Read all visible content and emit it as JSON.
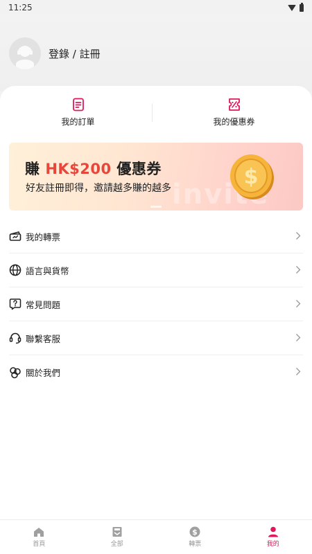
{
  "status_bar": {
    "time": "11:25"
  },
  "profile": {
    "login_label": "登錄 / 註冊"
  },
  "quick_links": [
    {
      "label": "我的訂單",
      "icon": "order-icon"
    },
    {
      "label": "我的優惠券",
      "icon": "coupon-icon"
    }
  ],
  "promo": {
    "title_prefix": "賺 ",
    "title_amount": "HK$200",
    "title_suffix": " 優惠券",
    "subtitle": "好友註冊即得，邀請越多賺的越多",
    "watermark": "invite"
  },
  "menu": [
    {
      "label": "我的轉票",
      "icon": "ticket-icon"
    },
    {
      "label": "語言與貨幣",
      "icon": "globe-icon"
    },
    {
      "label": "常見問題",
      "icon": "question-icon"
    },
    {
      "label": "聯繫客服",
      "icon": "headset-icon"
    },
    {
      "label": "關於我們",
      "icon": "about-icon"
    }
  ],
  "tabs": [
    {
      "label": "首頁",
      "icon": "home-icon",
      "active": false
    },
    {
      "label": "全部",
      "icon": "all-icon",
      "active": false
    },
    {
      "label": "轉票",
      "icon": "dollar-icon",
      "active": false
    },
    {
      "label": "我的",
      "icon": "person-icon",
      "active": true
    }
  ],
  "colors": {
    "accent": "#e0185a",
    "promo_accent": "#e8463a",
    "inactive": "#999999"
  }
}
